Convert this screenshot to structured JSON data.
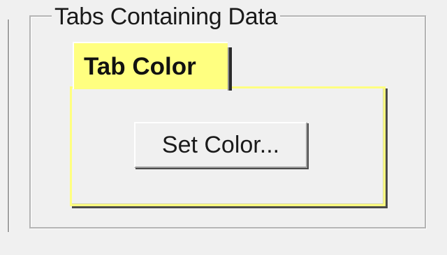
{
  "group": {
    "title": "Tabs Containing Data"
  },
  "tabs": [
    {
      "label": "Tab Color",
      "active": true,
      "color": "#ffff80"
    }
  ],
  "panel": {
    "set_color_button": "Set Color..."
  },
  "colors": {
    "tab_highlight": "#ffff80",
    "window_background": "#f0f0f0"
  }
}
